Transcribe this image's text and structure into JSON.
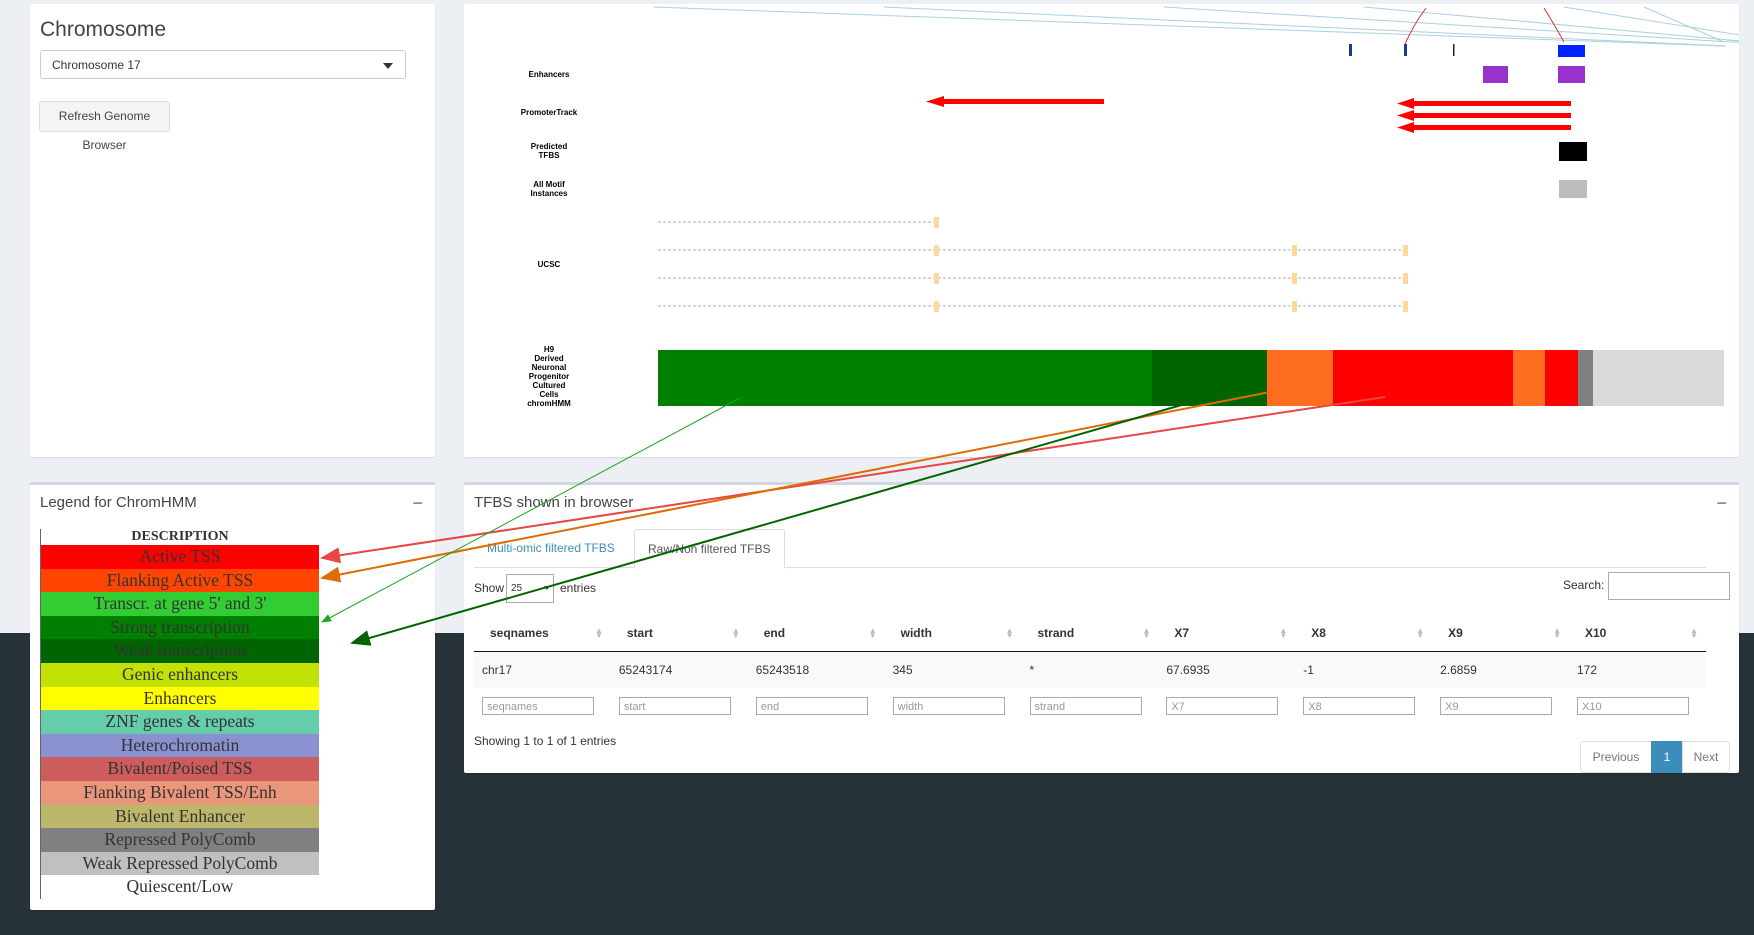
{
  "chromosome_panel": {
    "title": "Chromosome",
    "select_value": "Chromosome 17",
    "refresh_label": "Refresh Genome Browser"
  },
  "browser": {
    "track_labels": {
      "enhancers": "Enhancers",
      "promoter": "PromoterTrack",
      "predicted_tfbs_1": "Predicted",
      "predicted_tfbs_2": "TFBS",
      "all_motif_1": "All Motif",
      "all_motif_2": "Instances",
      "ucsc": "UCSC",
      "chromhmm": [
        "H9",
        "Derived",
        "Neuronal",
        "Progenitor",
        "Cultured",
        "Cells",
        "chromHMM"
      ]
    },
    "colors": {
      "green": "#008000",
      "dark_green": "#006400",
      "orange": "#ff6e1e",
      "red": "#ff0000",
      "grey": "#808080",
      "light_grey": "#d9d9d9",
      "purple": "#9932cc",
      "blue": "#0000ff",
      "exon": "#fcd89a"
    }
  },
  "legend": {
    "title": "Legend for ChromHMM",
    "collapse": "−",
    "header": "DESCRIPTION",
    "rows": [
      {
        "label": "Active TSS",
        "color": "#ff0000"
      },
      {
        "label": "Flanking Active TSS",
        "color": "#ff4500"
      },
      {
        "label": "Transcr. at gene 5' and 3'",
        "color": "#32cd32"
      },
      {
        "label": "Strong transcription",
        "color": "#008000"
      },
      {
        "label": "Weak transcription",
        "color": "#006400"
      },
      {
        "label": "Genic enhancers",
        "color": "#c2e105"
      },
      {
        "label": "Enhancers",
        "color": "#ffff00"
      },
      {
        "label": "ZNF genes & repeats",
        "color": "#66cdaa"
      },
      {
        "label": "Heterochromatin",
        "color": "#8a91d0"
      },
      {
        "label": "Bivalent/Poised TSS",
        "color": "#cd5c5c"
      },
      {
        "label": "Flanking Bivalent TSS/Enh",
        "color": "#e9967a"
      },
      {
        "label": "Bivalent Enhancer",
        "color": "#bdb76b"
      },
      {
        "label": "Repressed PolyComb",
        "color": "#808080"
      },
      {
        "label": "Weak Repressed PolyComb",
        "color": "#c0c0c0"
      },
      {
        "label": "Quiescent/Low",
        "color": "#ffffff"
      }
    ]
  },
  "tfbs": {
    "title": "TFBS shown in browser",
    "collapse": "−",
    "tabs": [
      "Multi-omic filtered TFBS",
      "Raw/Non filtered TFBS"
    ],
    "show_label": "Show",
    "show_value": "25",
    "entries_label": "entries",
    "search_label": "Search:",
    "columns": [
      "seqnames",
      "start",
      "end",
      "width",
      "strand",
      "X7",
      "X8",
      "X9",
      "X10"
    ],
    "rows": [
      [
        "chr17",
        "65243174",
        "65243518",
        "345",
        "*",
        "67.6935",
        "-1",
        "2.6859",
        "172"
      ]
    ],
    "filters": [
      "seqnames",
      "start",
      "end",
      "width",
      "strand",
      "X7",
      "X8",
      "X9",
      "X10"
    ],
    "info": "Showing 1 to 1 of 1 entries",
    "pagination": {
      "previous": "Previous",
      "page": "1",
      "next": "Next"
    },
    "accent": "#3c8dbc"
  }
}
